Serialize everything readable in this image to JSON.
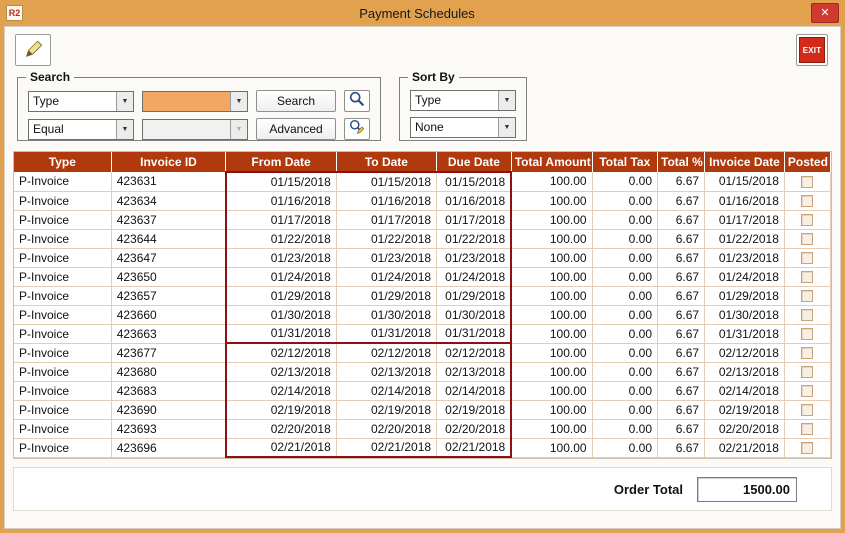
{
  "colors": {
    "chrome": "#e2a14e",
    "content-bg": "#fbfaf7",
    "close-red": "#cf3a30",
    "exit-red": "#d42a1a",
    "header-bg": "#b0390d",
    "header-text": "#ffffff",
    "highlight": "#f4a763",
    "grid-line": "#e2cdb6",
    "grp": "#8c1210"
  },
  "icons": {
    "close": "✕",
    "dropdown_arrow": "▼",
    "edit": "pencil",
    "search": "magnifier",
    "advanced": "magnifier-pencil"
  },
  "window": {
    "title": "Payment Schedules",
    "app_icon_text": "R2"
  },
  "toolbar": {
    "exit_label": "EXIT"
  },
  "search": {
    "legend": "Search",
    "field_value": "Type",
    "operator_value": "Equal",
    "value1": "",
    "value2": "",
    "search_button": "Search",
    "advanced_button": "Advanced"
  },
  "sort": {
    "legend": "Sort By",
    "primary_value": "Type",
    "secondary_value": "None"
  },
  "table": {
    "columns": [
      "Type",
      "Invoice ID",
      "From Date",
      "To Date",
      "Due Date",
      "Total Amount",
      "Total Tax",
      "Total %",
      "Invoice Date",
      "Posted"
    ],
    "row_keys": [
      "type",
      "invoice_id",
      "from",
      "to",
      "due",
      "amount",
      "tax",
      "pct",
      "invoice_date",
      "posted"
    ],
    "rows": [
      {
        "type": "P-Invoice",
        "invoice_id": "423631",
        "from": "01/15/2018",
        "to": "01/15/2018",
        "due": "01/15/2018",
        "amount": "100.00",
        "tax": "0.00",
        "pct": "6.67",
        "invoice_date": "01/15/2018",
        "posted": false,
        "group": 1
      },
      {
        "type": "P-Invoice",
        "invoice_id": "423634",
        "from": "01/16/2018",
        "to": "01/16/2018",
        "due": "01/16/2018",
        "amount": "100.00",
        "tax": "0.00",
        "pct": "6.67",
        "invoice_date": "01/16/2018",
        "posted": false,
        "group": 1
      },
      {
        "type": "P-Invoice",
        "invoice_id": "423637",
        "from": "01/17/2018",
        "to": "01/17/2018",
        "due": "01/17/2018",
        "amount": "100.00",
        "tax": "0.00",
        "pct": "6.67",
        "invoice_date": "01/17/2018",
        "posted": false,
        "group": 1
      },
      {
        "type": "P-Invoice",
        "invoice_id": "423644",
        "from": "01/22/2018",
        "to": "01/22/2018",
        "due": "01/22/2018",
        "amount": "100.00",
        "tax": "0.00",
        "pct": "6.67",
        "invoice_date": "01/22/2018",
        "posted": false,
        "group": 1
      },
      {
        "type": "P-Invoice",
        "invoice_id": "423647",
        "from": "01/23/2018",
        "to": "01/23/2018",
        "due": "01/23/2018",
        "amount": "100.00",
        "tax": "0.00",
        "pct": "6.67",
        "invoice_date": "01/23/2018",
        "posted": false,
        "group": 1
      },
      {
        "type": "P-Invoice",
        "invoice_id": "423650",
        "from": "01/24/2018",
        "to": "01/24/2018",
        "due": "01/24/2018",
        "amount": "100.00",
        "tax": "0.00",
        "pct": "6.67",
        "invoice_date": "01/24/2018",
        "posted": false,
        "group": 1
      },
      {
        "type": "P-Invoice",
        "invoice_id": "423657",
        "from": "01/29/2018",
        "to": "01/29/2018",
        "due": "01/29/2018",
        "amount": "100.00",
        "tax": "0.00",
        "pct": "6.67",
        "invoice_date": "01/29/2018",
        "posted": false,
        "group": 1
      },
      {
        "type": "P-Invoice",
        "invoice_id": "423660",
        "from": "01/30/2018",
        "to": "01/30/2018",
        "due": "01/30/2018",
        "amount": "100.00",
        "tax": "0.00",
        "pct": "6.67",
        "invoice_date": "01/30/2018",
        "posted": false,
        "group": 1
      },
      {
        "type": "P-Invoice",
        "invoice_id": "423663",
        "from": "01/31/2018",
        "to": "01/31/2018",
        "due": "01/31/2018",
        "amount": "100.00",
        "tax": "0.00",
        "pct": "6.67",
        "invoice_date": "01/31/2018",
        "posted": false,
        "group": 1
      },
      {
        "type": "P-Invoice",
        "invoice_id": "423677",
        "from": "02/12/2018",
        "to": "02/12/2018",
        "due": "02/12/2018",
        "amount": "100.00",
        "tax": "0.00",
        "pct": "6.67",
        "invoice_date": "02/12/2018",
        "posted": false,
        "group": 2
      },
      {
        "type": "P-Invoice",
        "invoice_id": "423680",
        "from": "02/13/2018",
        "to": "02/13/2018",
        "due": "02/13/2018",
        "amount": "100.00",
        "tax": "0.00",
        "pct": "6.67",
        "invoice_date": "02/13/2018",
        "posted": false,
        "group": 2
      },
      {
        "type": "P-Invoice",
        "invoice_id": "423683",
        "from": "02/14/2018",
        "to": "02/14/2018",
        "due": "02/14/2018",
        "amount": "100.00",
        "tax": "0.00",
        "pct": "6.67",
        "invoice_date": "02/14/2018",
        "posted": false,
        "group": 2
      },
      {
        "type": "P-Invoice",
        "invoice_id": "423690",
        "from": "02/19/2018",
        "to": "02/19/2018",
        "due": "02/19/2018",
        "amount": "100.00",
        "tax": "0.00",
        "pct": "6.67",
        "invoice_date": "02/19/2018",
        "posted": false,
        "group": 2
      },
      {
        "type": "P-Invoice",
        "invoice_id": "423693",
        "from": "02/20/2018",
        "to": "02/20/2018",
        "due": "02/20/2018",
        "amount": "100.00",
        "tax": "0.00",
        "pct": "6.67",
        "invoice_date": "02/20/2018",
        "posted": false,
        "group": 2
      },
      {
        "type": "P-Invoice",
        "invoice_id": "423696",
        "from": "02/21/2018",
        "to": "02/21/2018",
        "due": "02/21/2018",
        "amount": "100.00",
        "tax": "0.00",
        "pct": "6.67",
        "invoice_date": "02/21/2018",
        "posted": false,
        "group": 2
      }
    ]
  },
  "footer": {
    "order_total_label": "Order Total",
    "order_total_value": "1500.00"
  }
}
